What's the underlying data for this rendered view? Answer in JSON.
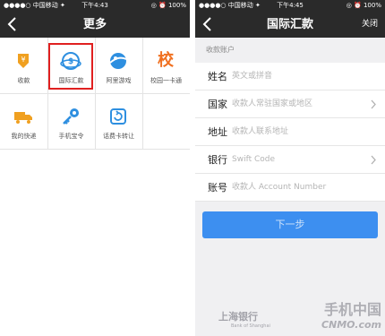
{
  "status_left": {
    "carrier": "●●●●○ 中国移动 ✦",
    "time": "下午4:43",
    "battery": "◎ ⏰ 100%"
  },
  "status_right": {
    "carrier": "●●●●○ 中国移动 ✦",
    "time": "下午4:45",
    "battery": "◎ ⏰ 100%"
  },
  "more_page": {
    "title": "更多",
    "items": [
      {
        "label": "收款",
        "icon": "shield-yen-icon",
        "color": "#f0a020"
      },
      {
        "label": "国际汇款",
        "icon": "globe-dollar-icon",
        "color": "#2e8fe0"
      },
      {
        "label": "阿里游戏",
        "icon": "planet-icon",
        "color": "#2e8fe0"
      },
      {
        "label": "校园一卡通",
        "icon": "school-char-icon",
        "glyph": "校",
        "color": "#f07020"
      },
      {
        "label": "我的快递",
        "icon": "truck-icon",
        "color": "#f0a020"
      },
      {
        "label": "手机宝令",
        "icon": "key-icon",
        "color": "#2e8fe0"
      },
      {
        "label": "话费卡转让",
        "icon": "refresh-card-icon",
        "color": "#2e8fe0"
      }
    ]
  },
  "remit_page": {
    "title": "国际汇款",
    "close_label": "关闭",
    "section": "收款账户",
    "rows": [
      {
        "label": "姓名",
        "placeholder": "英文或拼音",
        "chevron": false
      },
      {
        "label": "国家",
        "placeholder": "收款人常驻国家或地区",
        "chevron": true
      },
      {
        "label": "地址",
        "placeholder": "收款人联系地址",
        "chevron": false
      },
      {
        "label": "银行",
        "placeholder": "Swift Code",
        "chevron": true
      },
      {
        "label": "账号",
        "placeholder": "收款人 Account Number",
        "chevron": false
      }
    ],
    "submit": "下一步"
  },
  "watermark": {
    "line1": "手机中国",
    "line2": "CNMO.com"
  },
  "bank": {
    "name": "上海银行",
    "sub": "Bank of Shanghai"
  },
  "colors": {
    "nav": "#2a2a2a",
    "accent": "#3d8ff0",
    "highlight": "#e02020"
  }
}
